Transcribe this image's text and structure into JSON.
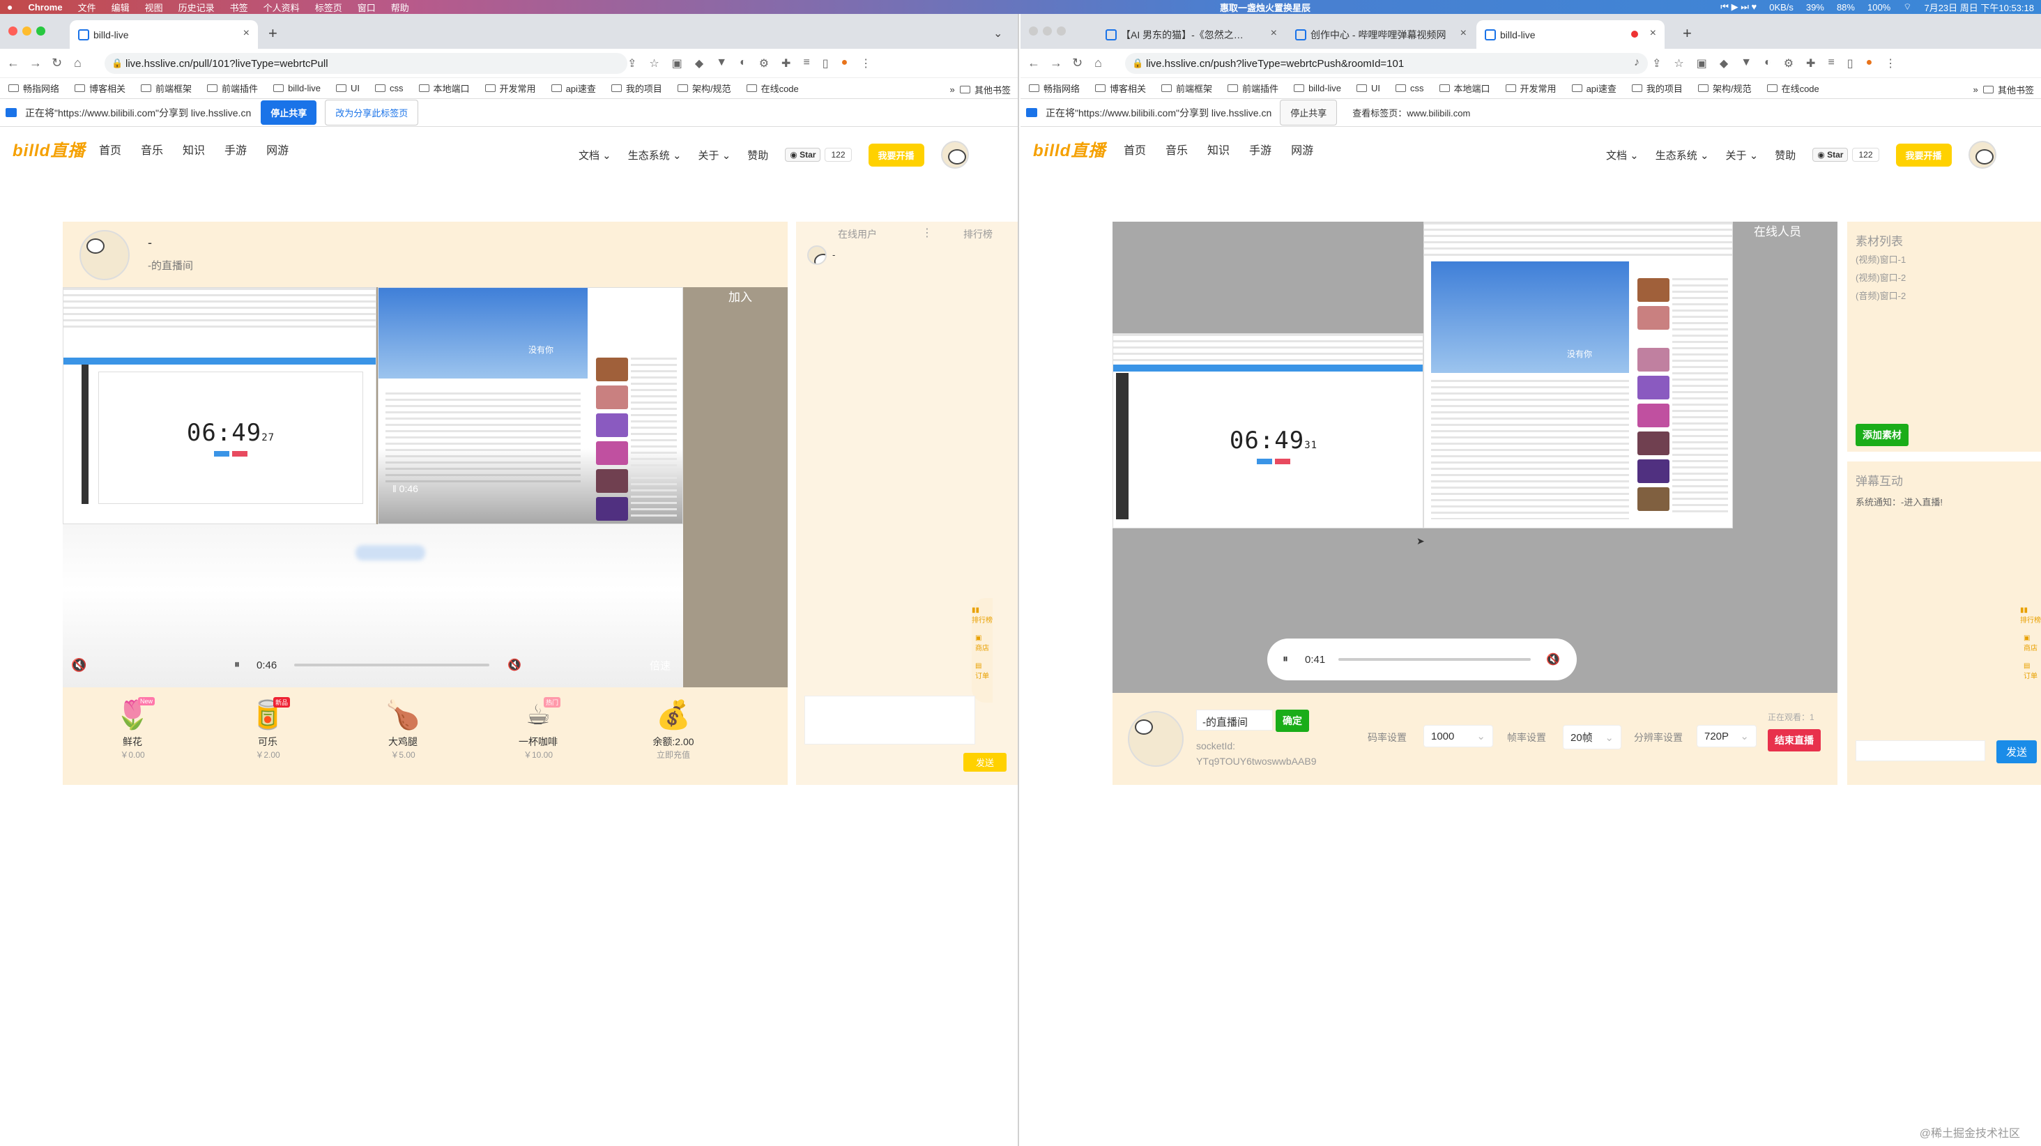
{
  "menubar": {
    "apple": "",
    "app": "Chrome",
    "items": [
      "文件",
      "编辑",
      "视图",
      "历史记录",
      "书签",
      "个人资料",
      "标签页",
      "窗口",
      "帮助"
    ],
    "center_text": "惠取一盏烛火置换星辰",
    "net": "0KB/s",
    "cpu": "39%",
    "mem": "88%",
    "battery": "100%",
    "datetime": "7月23日 周日 下午10:53:18"
  },
  "left": {
    "tab_title": "billd-live",
    "url": "live.hsslive.cn/pull/101?liveType=webrtcPull",
    "bookmarks": [
      "畅指网络",
      "博客相关",
      "前端框架",
      "前端插件",
      "billd-live",
      "UI",
      "css",
      "本地端口",
      "开发常用",
      "api速查",
      "我的项目",
      "架构/规范",
      "在线code"
    ],
    "bookmarks_other": "其他书签",
    "share_text": "正在将\"https://www.bilibili.com\"分享到 live.hsslive.cn",
    "stop_share": "停止共享",
    "share_this_tab": "改为分享此标签页",
    "room_title": "-",
    "room_sub": "-的直播间",
    "join_label": "加入",
    "clock": "06:49",
    "clock_sec": "27",
    "video_time": "0:46",
    "speed_label": "倍速",
    "online_users": "在线用户",
    "rank": "排行榜",
    "online_user_name": "-",
    "send": "发送",
    "gifts": [
      {
        "name": "鲜花",
        "price": "￥0.00",
        "icon": "🌷",
        "badge": "New"
      },
      {
        "name": "可乐",
        "price": "￥2.00",
        "icon": "🥫",
        "badge": "新品"
      },
      {
        "name": "大鸡腿",
        "price": "￥5.00",
        "icon": "🍗",
        "badge": ""
      },
      {
        "name": "一杯咖啡",
        "price": "￥10.00",
        "icon": "☕",
        "badge": "热门"
      },
      {
        "name": "余额:2.00",
        "price": "立即充值",
        "icon": "💰",
        "badge": ""
      }
    ],
    "float_items": [
      "排行榜",
      "商店",
      "订单"
    ]
  },
  "right": {
    "tabs": [
      "【AI 男东的猫】-《忽然之…",
      "创作中心 - 哔哩哔哩弹幕视频网",
      "billd-live"
    ],
    "url": "live.hsslive.cn/push?liveType=webrtcPush&roomId=101",
    "share_text": "正在将\"https://www.bilibili.com\"分享到 live.hsslive.cn",
    "stop_share": "停止共享",
    "view_tab": "查看标签页：www.bilibili.com",
    "online_people": "在线人员",
    "clock": "06:49",
    "clock_sec": "31",
    "video_time": "0:41",
    "room_input": "-的直播间",
    "confirm": "确定",
    "socket_label": "socketId:",
    "socket_id": "YTq9TOUY6twoswwbAAB9",
    "bitrate_label": "码率设置",
    "bitrate_value": "1000",
    "fps_label": "帧率设置",
    "fps_value": "20帧",
    "res_label": "分辨率设置",
    "res_value": "720P",
    "watching": "正在观看：1",
    "end_live": "结束直播",
    "material_title": "素材列表",
    "materials": [
      "(视频)窗口-1",
      "(视频)窗口-2",
      "(音频)窗口-2"
    ],
    "add_material": "添加素材",
    "danmu_title": "弹幕互动",
    "system_msg": "系统通知：-进入直播!",
    "send": "发送",
    "float_items": [
      "排行榜",
      "商店",
      "订单"
    ]
  },
  "site": {
    "logo": "billd直播",
    "nav": [
      "首页",
      "音乐",
      "知识",
      "手游",
      "网游"
    ],
    "nav_right": [
      "文档",
      "生态系统",
      "关于",
      "赞助"
    ],
    "star": "Star",
    "star_count": "122",
    "start_live": "我要开播"
  },
  "watermark": "@稀土掘金技术社区",
  "colors": {
    "accent": "#ffd100",
    "cream": "#fdf0d9",
    "blue": "#1a73e8",
    "green": "#1aad19",
    "red": "#e8314c"
  }
}
